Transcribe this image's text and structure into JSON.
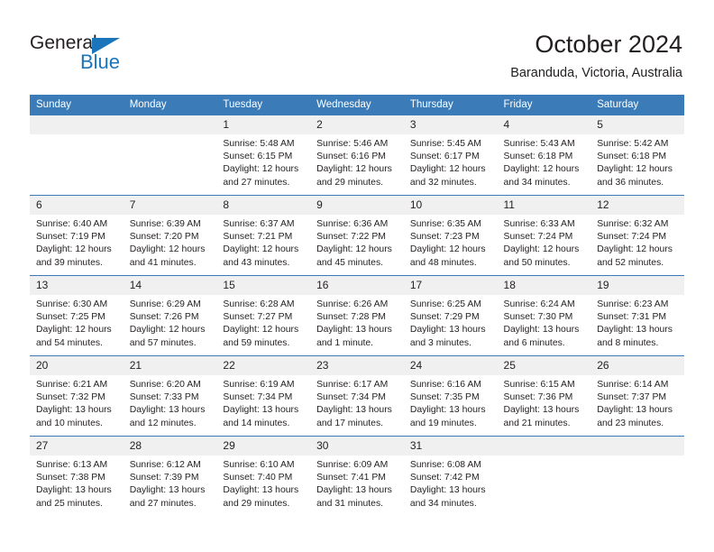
{
  "brand": {
    "name_top": "General",
    "name_bottom": "Blue",
    "triangle_color": "#1b75bb",
    "text_color": "#231f20"
  },
  "header": {
    "month_title": "October 2024",
    "location": "Baranduda, Victoria, Australia"
  },
  "colors": {
    "header_blue": "#3b7cb8",
    "daynum_band": "#f0f0f0",
    "text": "#231f20",
    "background": "#ffffff"
  },
  "weekdays": [
    "Sunday",
    "Monday",
    "Tuesday",
    "Wednesday",
    "Thursday",
    "Friday",
    "Saturday"
  ],
  "weeks": [
    [
      {
        "day": "",
        "sunrise": "",
        "sunset": "",
        "daylight_1": "",
        "daylight_2": ""
      },
      {
        "day": "",
        "sunrise": "",
        "sunset": "",
        "daylight_1": "",
        "daylight_2": ""
      },
      {
        "day": "1",
        "sunrise": "Sunrise: 5:48 AM",
        "sunset": "Sunset: 6:15 PM",
        "daylight_1": "Daylight: 12 hours",
        "daylight_2": "and 27 minutes."
      },
      {
        "day": "2",
        "sunrise": "Sunrise: 5:46 AM",
        "sunset": "Sunset: 6:16 PM",
        "daylight_1": "Daylight: 12 hours",
        "daylight_2": "and 29 minutes."
      },
      {
        "day": "3",
        "sunrise": "Sunrise: 5:45 AM",
        "sunset": "Sunset: 6:17 PM",
        "daylight_1": "Daylight: 12 hours",
        "daylight_2": "and 32 minutes."
      },
      {
        "day": "4",
        "sunrise": "Sunrise: 5:43 AM",
        "sunset": "Sunset: 6:18 PM",
        "daylight_1": "Daylight: 12 hours",
        "daylight_2": "and 34 minutes."
      },
      {
        "day": "5",
        "sunrise": "Sunrise: 5:42 AM",
        "sunset": "Sunset: 6:18 PM",
        "daylight_1": "Daylight: 12 hours",
        "daylight_2": "and 36 minutes."
      }
    ],
    [
      {
        "day": "6",
        "sunrise": "Sunrise: 6:40 AM",
        "sunset": "Sunset: 7:19 PM",
        "daylight_1": "Daylight: 12 hours",
        "daylight_2": "and 39 minutes."
      },
      {
        "day": "7",
        "sunrise": "Sunrise: 6:39 AM",
        "sunset": "Sunset: 7:20 PM",
        "daylight_1": "Daylight: 12 hours",
        "daylight_2": "and 41 minutes."
      },
      {
        "day": "8",
        "sunrise": "Sunrise: 6:37 AM",
        "sunset": "Sunset: 7:21 PM",
        "daylight_1": "Daylight: 12 hours",
        "daylight_2": "and 43 minutes."
      },
      {
        "day": "9",
        "sunrise": "Sunrise: 6:36 AM",
        "sunset": "Sunset: 7:22 PM",
        "daylight_1": "Daylight: 12 hours",
        "daylight_2": "and 45 minutes."
      },
      {
        "day": "10",
        "sunrise": "Sunrise: 6:35 AM",
        "sunset": "Sunset: 7:23 PM",
        "daylight_1": "Daylight: 12 hours",
        "daylight_2": "and 48 minutes."
      },
      {
        "day": "11",
        "sunrise": "Sunrise: 6:33 AM",
        "sunset": "Sunset: 7:24 PM",
        "daylight_1": "Daylight: 12 hours",
        "daylight_2": "and 50 minutes."
      },
      {
        "day": "12",
        "sunrise": "Sunrise: 6:32 AM",
        "sunset": "Sunset: 7:24 PM",
        "daylight_1": "Daylight: 12 hours",
        "daylight_2": "and 52 minutes."
      }
    ],
    [
      {
        "day": "13",
        "sunrise": "Sunrise: 6:30 AM",
        "sunset": "Sunset: 7:25 PM",
        "daylight_1": "Daylight: 12 hours",
        "daylight_2": "and 54 minutes."
      },
      {
        "day": "14",
        "sunrise": "Sunrise: 6:29 AM",
        "sunset": "Sunset: 7:26 PM",
        "daylight_1": "Daylight: 12 hours",
        "daylight_2": "and 57 minutes."
      },
      {
        "day": "15",
        "sunrise": "Sunrise: 6:28 AM",
        "sunset": "Sunset: 7:27 PM",
        "daylight_1": "Daylight: 12 hours",
        "daylight_2": "and 59 minutes."
      },
      {
        "day": "16",
        "sunrise": "Sunrise: 6:26 AM",
        "sunset": "Sunset: 7:28 PM",
        "daylight_1": "Daylight: 13 hours",
        "daylight_2": "and 1 minute."
      },
      {
        "day": "17",
        "sunrise": "Sunrise: 6:25 AM",
        "sunset": "Sunset: 7:29 PM",
        "daylight_1": "Daylight: 13 hours",
        "daylight_2": "and 3 minutes."
      },
      {
        "day": "18",
        "sunrise": "Sunrise: 6:24 AM",
        "sunset": "Sunset: 7:30 PM",
        "daylight_1": "Daylight: 13 hours",
        "daylight_2": "and 6 minutes."
      },
      {
        "day": "19",
        "sunrise": "Sunrise: 6:23 AM",
        "sunset": "Sunset: 7:31 PM",
        "daylight_1": "Daylight: 13 hours",
        "daylight_2": "and 8 minutes."
      }
    ],
    [
      {
        "day": "20",
        "sunrise": "Sunrise: 6:21 AM",
        "sunset": "Sunset: 7:32 PM",
        "daylight_1": "Daylight: 13 hours",
        "daylight_2": "and 10 minutes."
      },
      {
        "day": "21",
        "sunrise": "Sunrise: 6:20 AM",
        "sunset": "Sunset: 7:33 PM",
        "daylight_1": "Daylight: 13 hours",
        "daylight_2": "and 12 minutes."
      },
      {
        "day": "22",
        "sunrise": "Sunrise: 6:19 AM",
        "sunset": "Sunset: 7:34 PM",
        "daylight_1": "Daylight: 13 hours",
        "daylight_2": "and 14 minutes."
      },
      {
        "day": "23",
        "sunrise": "Sunrise: 6:17 AM",
        "sunset": "Sunset: 7:34 PM",
        "daylight_1": "Daylight: 13 hours",
        "daylight_2": "and 17 minutes."
      },
      {
        "day": "24",
        "sunrise": "Sunrise: 6:16 AM",
        "sunset": "Sunset: 7:35 PM",
        "daylight_1": "Daylight: 13 hours",
        "daylight_2": "and 19 minutes."
      },
      {
        "day": "25",
        "sunrise": "Sunrise: 6:15 AM",
        "sunset": "Sunset: 7:36 PM",
        "daylight_1": "Daylight: 13 hours",
        "daylight_2": "and 21 minutes."
      },
      {
        "day": "26",
        "sunrise": "Sunrise: 6:14 AM",
        "sunset": "Sunset: 7:37 PM",
        "daylight_1": "Daylight: 13 hours",
        "daylight_2": "and 23 minutes."
      }
    ],
    [
      {
        "day": "27",
        "sunrise": "Sunrise: 6:13 AM",
        "sunset": "Sunset: 7:38 PM",
        "daylight_1": "Daylight: 13 hours",
        "daylight_2": "and 25 minutes."
      },
      {
        "day": "28",
        "sunrise": "Sunrise: 6:12 AM",
        "sunset": "Sunset: 7:39 PM",
        "daylight_1": "Daylight: 13 hours",
        "daylight_2": "and 27 minutes."
      },
      {
        "day": "29",
        "sunrise": "Sunrise: 6:10 AM",
        "sunset": "Sunset: 7:40 PM",
        "daylight_1": "Daylight: 13 hours",
        "daylight_2": "and 29 minutes."
      },
      {
        "day": "30",
        "sunrise": "Sunrise: 6:09 AM",
        "sunset": "Sunset: 7:41 PM",
        "daylight_1": "Daylight: 13 hours",
        "daylight_2": "and 31 minutes."
      },
      {
        "day": "31",
        "sunrise": "Sunrise: 6:08 AM",
        "sunset": "Sunset: 7:42 PM",
        "daylight_1": "Daylight: 13 hours",
        "daylight_2": "and 34 minutes."
      },
      {
        "day": "",
        "sunrise": "",
        "sunset": "",
        "daylight_1": "",
        "daylight_2": ""
      },
      {
        "day": "",
        "sunrise": "",
        "sunset": "",
        "daylight_1": "",
        "daylight_2": ""
      }
    ]
  ]
}
